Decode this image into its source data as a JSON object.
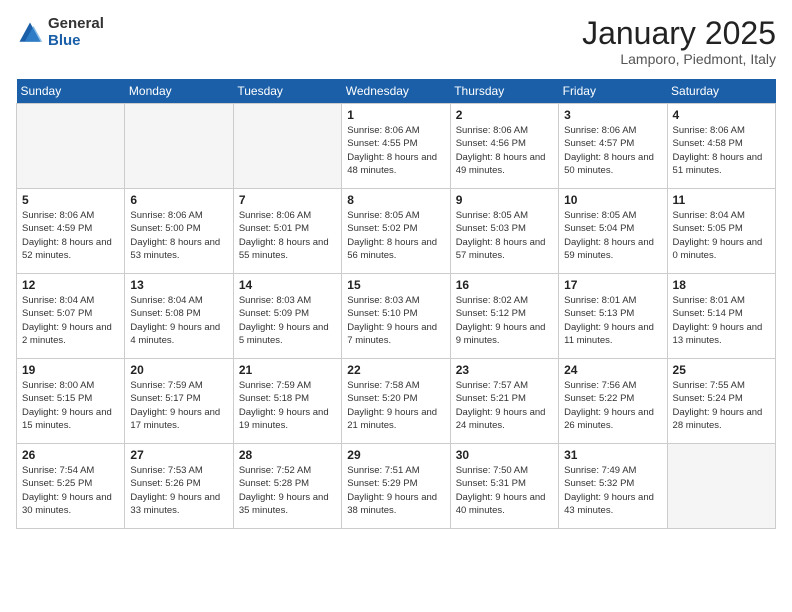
{
  "logo": {
    "general": "General",
    "blue": "Blue"
  },
  "title": "January 2025",
  "subtitle": "Lamporo, Piedmont, Italy",
  "days_header": [
    "Sunday",
    "Monday",
    "Tuesday",
    "Wednesday",
    "Thursday",
    "Friday",
    "Saturday"
  ],
  "weeks": [
    [
      {
        "num": "",
        "info": ""
      },
      {
        "num": "",
        "info": ""
      },
      {
        "num": "",
        "info": ""
      },
      {
        "num": "1",
        "info": "Sunrise: 8:06 AM\nSunset: 4:55 PM\nDaylight: 8 hours\nand 48 minutes."
      },
      {
        "num": "2",
        "info": "Sunrise: 8:06 AM\nSunset: 4:56 PM\nDaylight: 8 hours\nand 49 minutes."
      },
      {
        "num": "3",
        "info": "Sunrise: 8:06 AM\nSunset: 4:57 PM\nDaylight: 8 hours\nand 50 minutes."
      },
      {
        "num": "4",
        "info": "Sunrise: 8:06 AM\nSunset: 4:58 PM\nDaylight: 8 hours\nand 51 minutes."
      }
    ],
    [
      {
        "num": "5",
        "info": "Sunrise: 8:06 AM\nSunset: 4:59 PM\nDaylight: 8 hours\nand 52 minutes."
      },
      {
        "num": "6",
        "info": "Sunrise: 8:06 AM\nSunset: 5:00 PM\nDaylight: 8 hours\nand 53 minutes."
      },
      {
        "num": "7",
        "info": "Sunrise: 8:06 AM\nSunset: 5:01 PM\nDaylight: 8 hours\nand 55 minutes."
      },
      {
        "num": "8",
        "info": "Sunrise: 8:05 AM\nSunset: 5:02 PM\nDaylight: 8 hours\nand 56 minutes."
      },
      {
        "num": "9",
        "info": "Sunrise: 8:05 AM\nSunset: 5:03 PM\nDaylight: 8 hours\nand 57 minutes."
      },
      {
        "num": "10",
        "info": "Sunrise: 8:05 AM\nSunset: 5:04 PM\nDaylight: 8 hours\nand 59 minutes."
      },
      {
        "num": "11",
        "info": "Sunrise: 8:04 AM\nSunset: 5:05 PM\nDaylight: 9 hours\nand 0 minutes."
      }
    ],
    [
      {
        "num": "12",
        "info": "Sunrise: 8:04 AM\nSunset: 5:07 PM\nDaylight: 9 hours\nand 2 minutes."
      },
      {
        "num": "13",
        "info": "Sunrise: 8:04 AM\nSunset: 5:08 PM\nDaylight: 9 hours\nand 4 minutes."
      },
      {
        "num": "14",
        "info": "Sunrise: 8:03 AM\nSunset: 5:09 PM\nDaylight: 9 hours\nand 5 minutes."
      },
      {
        "num": "15",
        "info": "Sunrise: 8:03 AM\nSunset: 5:10 PM\nDaylight: 9 hours\nand 7 minutes."
      },
      {
        "num": "16",
        "info": "Sunrise: 8:02 AM\nSunset: 5:12 PM\nDaylight: 9 hours\nand 9 minutes."
      },
      {
        "num": "17",
        "info": "Sunrise: 8:01 AM\nSunset: 5:13 PM\nDaylight: 9 hours\nand 11 minutes."
      },
      {
        "num": "18",
        "info": "Sunrise: 8:01 AM\nSunset: 5:14 PM\nDaylight: 9 hours\nand 13 minutes."
      }
    ],
    [
      {
        "num": "19",
        "info": "Sunrise: 8:00 AM\nSunset: 5:15 PM\nDaylight: 9 hours\nand 15 minutes."
      },
      {
        "num": "20",
        "info": "Sunrise: 7:59 AM\nSunset: 5:17 PM\nDaylight: 9 hours\nand 17 minutes."
      },
      {
        "num": "21",
        "info": "Sunrise: 7:59 AM\nSunset: 5:18 PM\nDaylight: 9 hours\nand 19 minutes."
      },
      {
        "num": "22",
        "info": "Sunrise: 7:58 AM\nSunset: 5:20 PM\nDaylight: 9 hours\nand 21 minutes."
      },
      {
        "num": "23",
        "info": "Sunrise: 7:57 AM\nSunset: 5:21 PM\nDaylight: 9 hours\nand 24 minutes."
      },
      {
        "num": "24",
        "info": "Sunrise: 7:56 AM\nSunset: 5:22 PM\nDaylight: 9 hours\nand 26 minutes."
      },
      {
        "num": "25",
        "info": "Sunrise: 7:55 AM\nSunset: 5:24 PM\nDaylight: 9 hours\nand 28 minutes."
      }
    ],
    [
      {
        "num": "26",
        "info": "Sunrise: 7:54 AM\nSunset: 5:25 PM\nDaylight: 9 hours\nand 30 minutes."
      },
      {
        "num": "27",
        "info": "Sunrise: 7:53 AM\nSunset: 5:26 PM\nDaylight: 9 hours\nand 33 minutes."
      },
      {
        "num": "28",
        "info": "Sunrise: 7:52 AM\nSunset: 5:28 PM\nDaylight: 9 hours\nand 35 minutes."
      },
      {
        "num": "29",
        "info": "Sunrise: 7:51 AM\nSunset: 5:29 PM\nDaylight: 9 hours\nand 38 minutes."
      },
      {
        "num": "30",
        "info": "Sunrise: 7:50 AM\nSunset: 5:31 PM\nDaylight: 9 hours\nand 40 minutes."
      },
      {
        "num": "31",
        "info": "Sunrise: 7:49 AM\nSunset: 5:32 PM\nDaylight: 9 hours\nand 43 minutes."
      },
      {
        "num": "",
        "info": ""
      }
    ]
  ]
}
